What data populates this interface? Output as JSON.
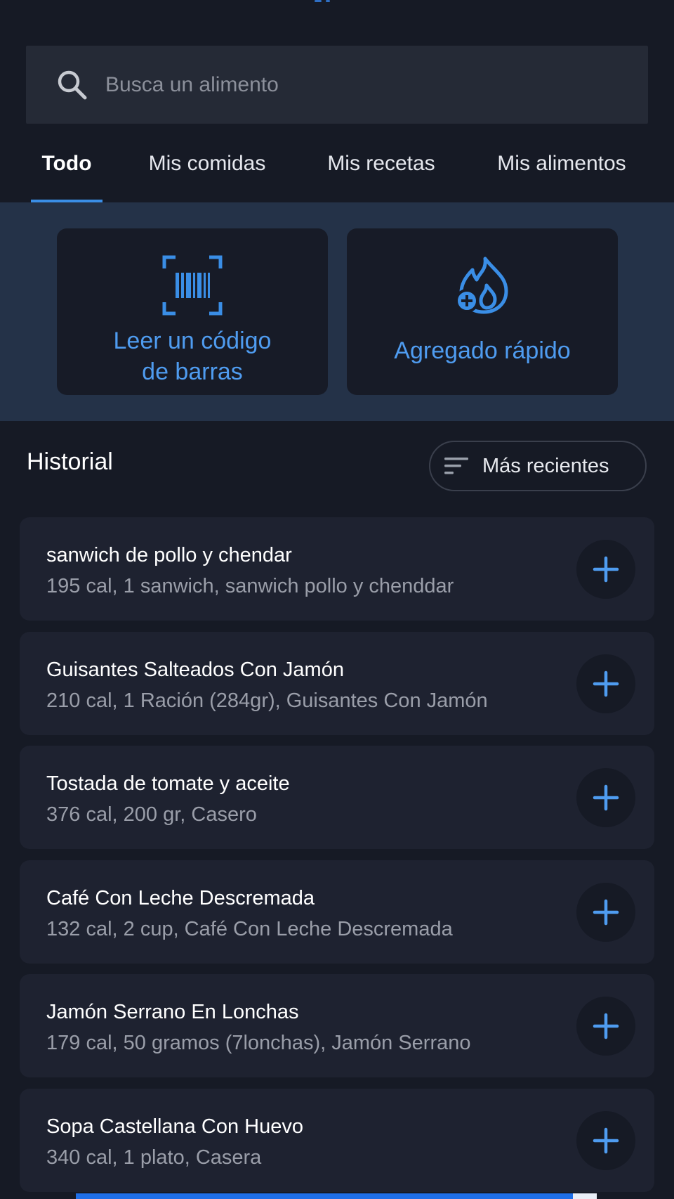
{
  "search": {
    "placeholder": "Busca un alimento",
    "value": ""
  },
  "tabs": [
    {
      "label": "Todo",
      "active": true
    },
    {
      "label": "Mis comidas",
      "active": false
    },
    {
      "label": "Mis recetas",
      "active": false
    },
    {
      "label": "Mis alimentos",
      "active": false
    }
  ],
  "actions": {
    "barcode": {
      "line1": "Leer un código",
      "line2": "de barras",
      "icon": "barcode-scan-icon"
    },
    "quick_add": {
      "label": "Agregado rápido",
      "icon": "flame-plus-icon"
    }
  },
  "history": {
    "title": "Historial",
    "sort_label": "Más recientes",
    "items": [
      {
        "name": "sanwich de pollo y chendar",
        "detail": "195 cal, 1 sanwich, sanwich pollo y chenddar"
      },
      {
        "name": "Guisantes Salteados Con Jamón",
        "detail": "210 cal, 1 Ración (284gr), Guisantes Con Jamón"
      },
      {
        "name": "Tostada de tomate y aceite",
        "detail": "376 cal, 200 gr, Casero"
      },
      {
        "name": "Café Con Leche Descremada",
        "detail": "132 cal, 2 cup, Café Con Leche Descremada"
      },
      {
        "name": "Jamón Serrano En Lonchas",
        "detail": "179 cal, 50 gramos (7lonchas), Jamón Serrano"
      },
      {
        "name": "Sopa Castellana Con Huevo",
        "detail": "340 cal, 1 plato, Casera"
      }
    ]
  },
  "colors": {
    "background": "#161a25",
    "accent": "#4f9cf0",
    "panel": "#243248",
    "card": "#1e2230"
  }
}
